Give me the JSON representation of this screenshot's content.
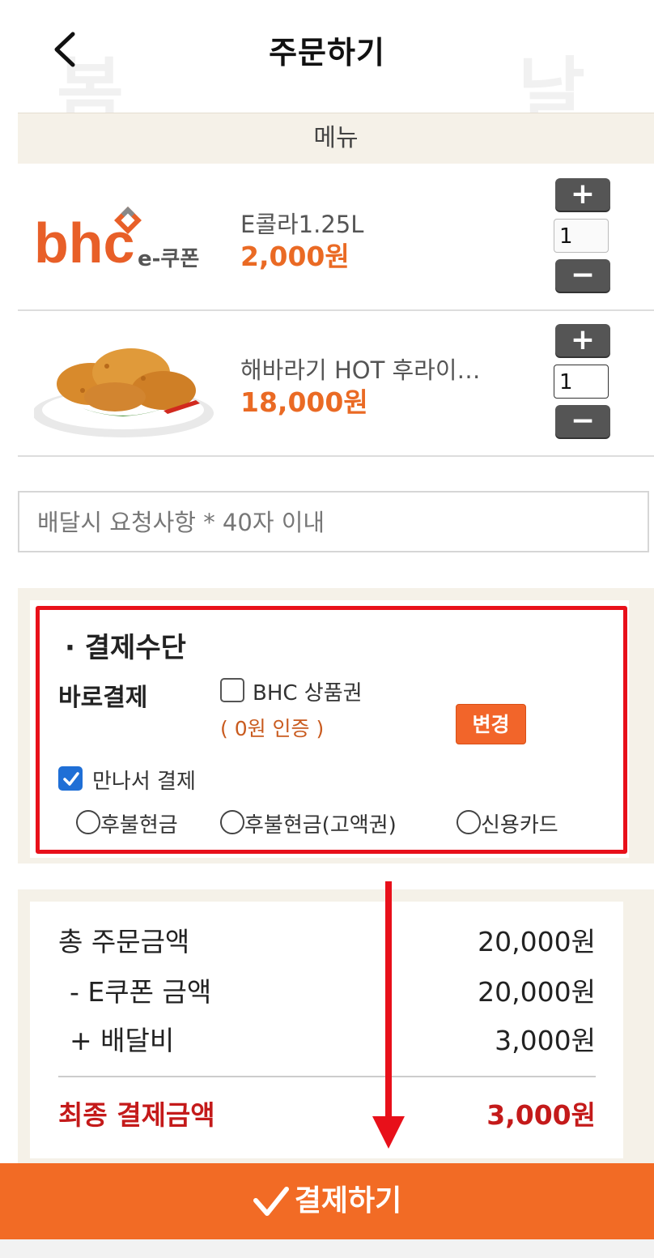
{
  "header": {
    "title": "주문하기",
    "watermark_left": "봄",
    "watermark_right": "날"
  },
  "menu": {
    "header_label": "메뉴",
    "items": [
      {
        "name": "E콜라1.25L",
        "price": "2,000원",
        "qty": "1",
        "plus": "+",
        "minus": "−",
        "logo_text": "bhc",
        "logo_sub": "e-쿠폰"
      },
      {
        "name": "해바라기 HOT 후라이…",
        "price": "18,000원",
        "qty": "1",
        "plus": "+",
        "minus": "−"
      }
    ]
  },
  "request": {
    "placeholder": "배달시 요청사항 * 40자 이내"
  },
  "payment": {
    "section_title": "· 결제수단",
    "direct_label": "바로결제",
    "giftcard_label": "BHC 상품권",
    "giftcard_checked": false,
    "auth_text": "( 0원 인증 )",
    "change_label": "변경",
    "meet_pay_label": "만나서 결제",
    "meet_pay_checked": true,
    "options": [
      "후불현금",
      "후불현금(고액권)",
      "신용카드"
    ]
  },
  "summary": {
    "total_label": "총 주문금액",
    "total_value": "20,000원",
    "coupon_label": "- E쿠폰 금액",
    "coupon_value": "20,000원",
    "delivery_label": "+ 배달비",
    "delivery_value": "3,000원",
    "final_label": "최종 결제금액",
    "final_value": "3,000원"
  },
  "pay_button": {
    "label": "결제하기"
  },
  "colors": {
    "accent": "#f26b25",
    "highlight": "#e8101a",
    "price": "#ea6a24",
    "final": "#c41a1a"
  }
}
